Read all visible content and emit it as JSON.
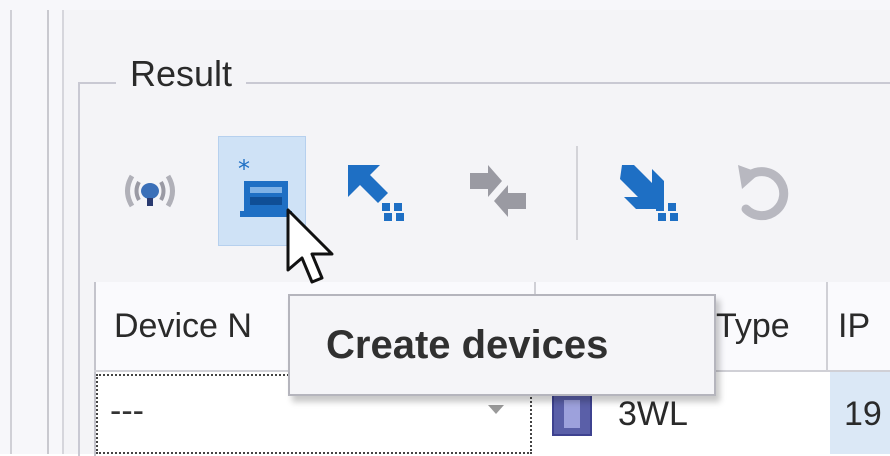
{
  "group": {
    "title": "Result"
  },
  "toolbar": {
    "buttons": [
      {
        "name": "signal",
        "icon": "wireless-signal-icon"
      },
      {
        "name": "create-devices",
        "icon": "create-devices-icon",
        "active": true
      },
      {
        "name": "upload",
        "icon": "upload-to-device-icon"
      },
      {
        "name": "exchange",
        "icon": "exchange-arrows-icon"
      },
      {
        "name": "download",
        "icon": "download-from-device-icon"
      },
      {
        "name": "undo",
        "icon": "undo-icon"
      }
    ]
  },
  "tooltip": {
    "text": "Create devices"
  },
  "grid": {
    "columns": [
      "Device N",
      "Type",
      "IP"
    ],
    "row": {
      "device_name": "---",
      "type": "3WL",
      "ip": "19"
    }
  },
  "colors": {
    "accent": "#cfe2f6",
    "icon_blue": "#1e6fc4",
    "selection": "#dbe8f6"
  }
}
